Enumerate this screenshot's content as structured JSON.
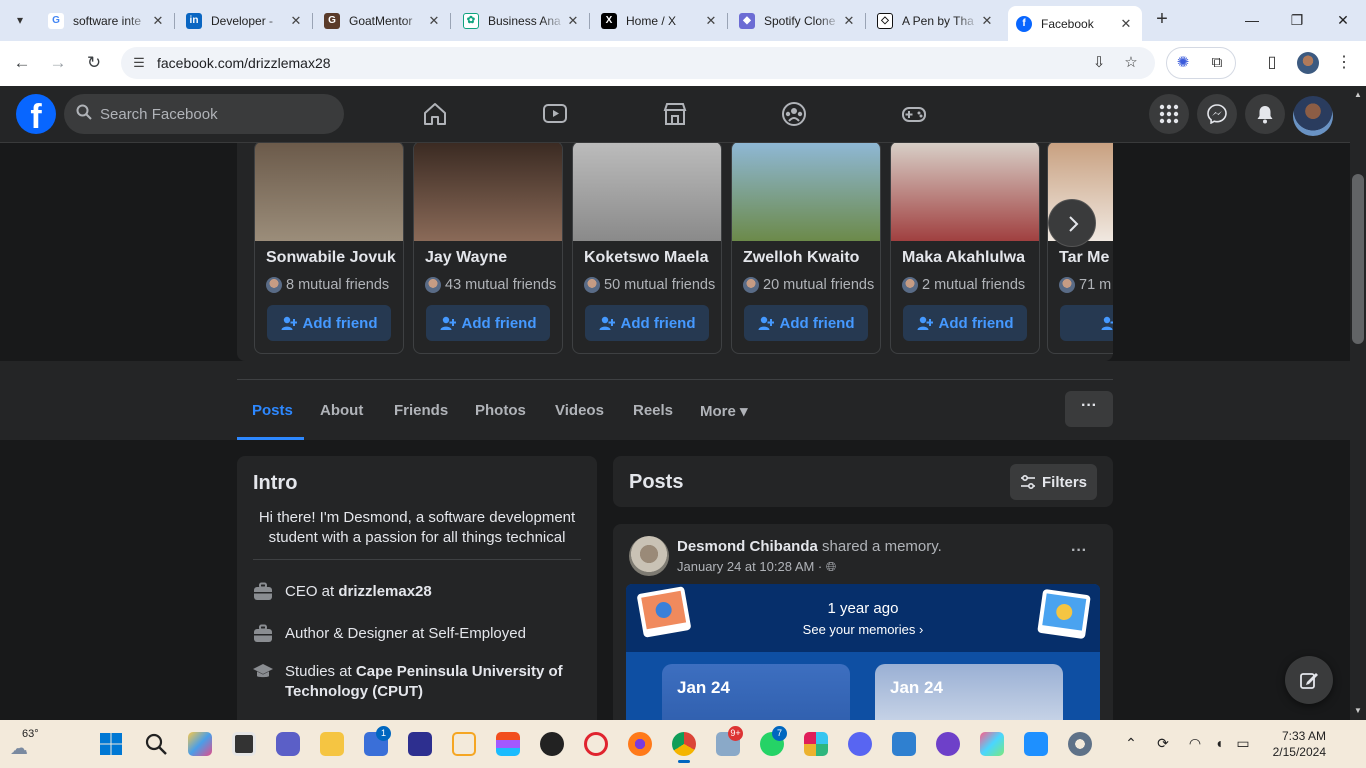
{
  "browser": {
    "tabs": [
      {
        "title": "software inte",
        "icon": "google-icon",
        "color": "#4285f4"
      },
      {
        "title": "Developer - ",
        "icon": "linkedin-icon",
        "color": "#0a66c2"
      },
      {
        "title": "GoatMentor",
        "icon": "goatmentor-icon",
        "color": "#5a3b2a"
      },
      {
        "title": "Business Ana",
        "icon": "chatgpt-icon",
        "color": "#10a37f"
      },
      {
        "title": "Home / X",
        "icon": "x-icon",
        "color": "#000000"
      },
      {
        "title": "Spotify Clone",
        "icon": "spotify-clone-icon",
        "color": "#6c6cd4"
      },
      {
        "title": "A Pen by Tha",
        "icon": "codepen-icon",
        "color": "#111111"
      },
      {
        "title": "Facebook",
        "icon": "facebook-icon",
        "color": "#0866ff",
        "active": true
      }
    ],
    "url": "facebook.com/drizzlemax28"
  },
  "facebook": {
    "search_placeholder": "Search Facebook",
    "suggestions": [
      {
        "name": "Sonwabile Jovuk",
        "mutual": "8 mutual friends",
        "button": "Add friend",
        "photo": [
          "#6b5a4a",
          "#9b8d7a"
        ]
      },
      {
        "name": "Jay Wayne",
        "mutual": "43 mutual friends",
        "button": "Add friend",
        "photo": [
          "#3a2a22",
          "#8a6a58"
        ]
      },
      {
        "name": "Koketswo Maela",
        "mutual": "50 mutual friends",
        "button": "Add friend",
        "photo": [
          "#bcbcbc",
          "#8a8a8a"
        ]
      },
      {
        "name": "Zwelloh Kwaito",
        "mutual": "20 mutual friends",
        "button": "Add friend",
        "photo": [
          "#8fb8d6",
          "#6c8a4a"
        ]
      },
      {
        "name": "Maka Akahlulwa",
        "mutual": "2 mutual friends",
        "button": "Add friend",
        "photo": [
          "#d8d0c8",
          "#a04040"
        ]
      },
      {
        "name": "Tar Me",
        "mutual": "71 m",
        "button": "Ac",
        "photo": [
          "#c8a080",
          "#f0e8e0"
        ]
      }
    ],
    "profile_tabs": [
      "Posts",
      "About",
      "Friends",
      "Photos",
      "Videos",
      "Reels",
      "More ▾"
    ],
    "more_dots": "···",
    "intro": {
      "title": "Intro",
      "bio": "Hi there! I'm Desmond, a software development student with a passion for all things technical",
      "work1_prefix": "CEO at ",
      "work1_org": "drizzlemax28",
      "work2": "Author & Designer at Self-Employed",
      "study_prefix": "Studies at ",
      "study_org": "Cape Peninsula University of Technology (CPUT)"
    },
    "posts": {
      "title": "Posts",
      "filters_label": "Filters",
      "author": "Desmond Chibanda",
      "action": " shared a memory.",
      "time": "January 24 at 10:28 AM · ",
      "memory_title": "1 year ago",
      "memory_link": "See your memories ›",
      "memory_dates": [
        "Jan 24",
        "Jan 24"
      ]
    }
  },
  "taskbar": {
    "temperature": "63°",
    "time": "7:33 AM",
    "date": "2/15/2024",
    "badges": {
      "store": "1",
      "mail": "9+",
      "whatsapp": "7"
    }
  }
}
